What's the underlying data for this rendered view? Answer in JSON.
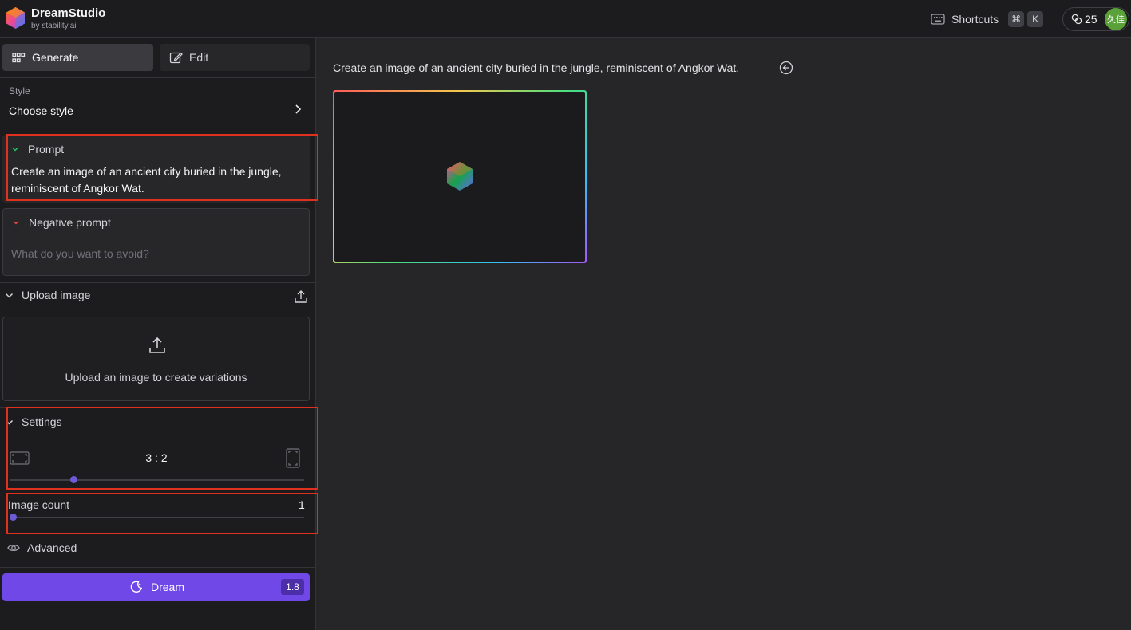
{
  "brand": {
    "name": "DreamStudio",
    "sub": "by stability.ai"
  },
  "topbar": {
    "shortcuts_label": "Shortcuts",
    "shortcut_keys": [
      "⌘",
      "K"
    ],
    "credits": "25",
    "avatar_text": "久佳"
  },
  "sidebar": {
    "tabs": [
      {
        "label": "Generate",
        "icon": "grid-icon",
        "active": true
      },
      {
        "label": "Edit",
        "icon": "edit-icon",
        "active": false
      }
    ],
    "style": {
      "label": "Style",
      "value": "Choose style"
    },
    "prompt": {
      "label": "Prompt",
      "text": "Create an image of an ancient city buried in the jungle, reminiscent of Angkor Wat."
    },
    "negative_prompt": {
      "label": "Negative prompt",
      "placeholder": "What do you want to avoid?",
      "value": ""
    },
    "upload": {
      "label": "Upload image",
      "zone_text": "Upload an image to create variations"
    },
    "settings": {
      "label": "Settings",
      "aspect_ratio": "3 : 2",
      "aspect_slider_fraction": 0.21
    },
    "image_count": {
      "label": "Image count",
      "value": "1",
      "slider_fraction": 0
    },
    "advanced": {
      "label": "Advanced"
    },
    "dream": {
      "label": "Dream",
      "cost": "1.8"
    }
  },
  "main": {
    "prompt_text": "Create an image of an ancient city buried in the jungle, reminiscent of Angkor Wat."
  },
  "colors": {
    "accent": "#7048e8",
    "highlight_box": "#e0301e",
    "prompt_chevron": "#22c55e",
    "negative_chevron": "#ef4444",
    "avatar": "#5aa13a"
  }
}
